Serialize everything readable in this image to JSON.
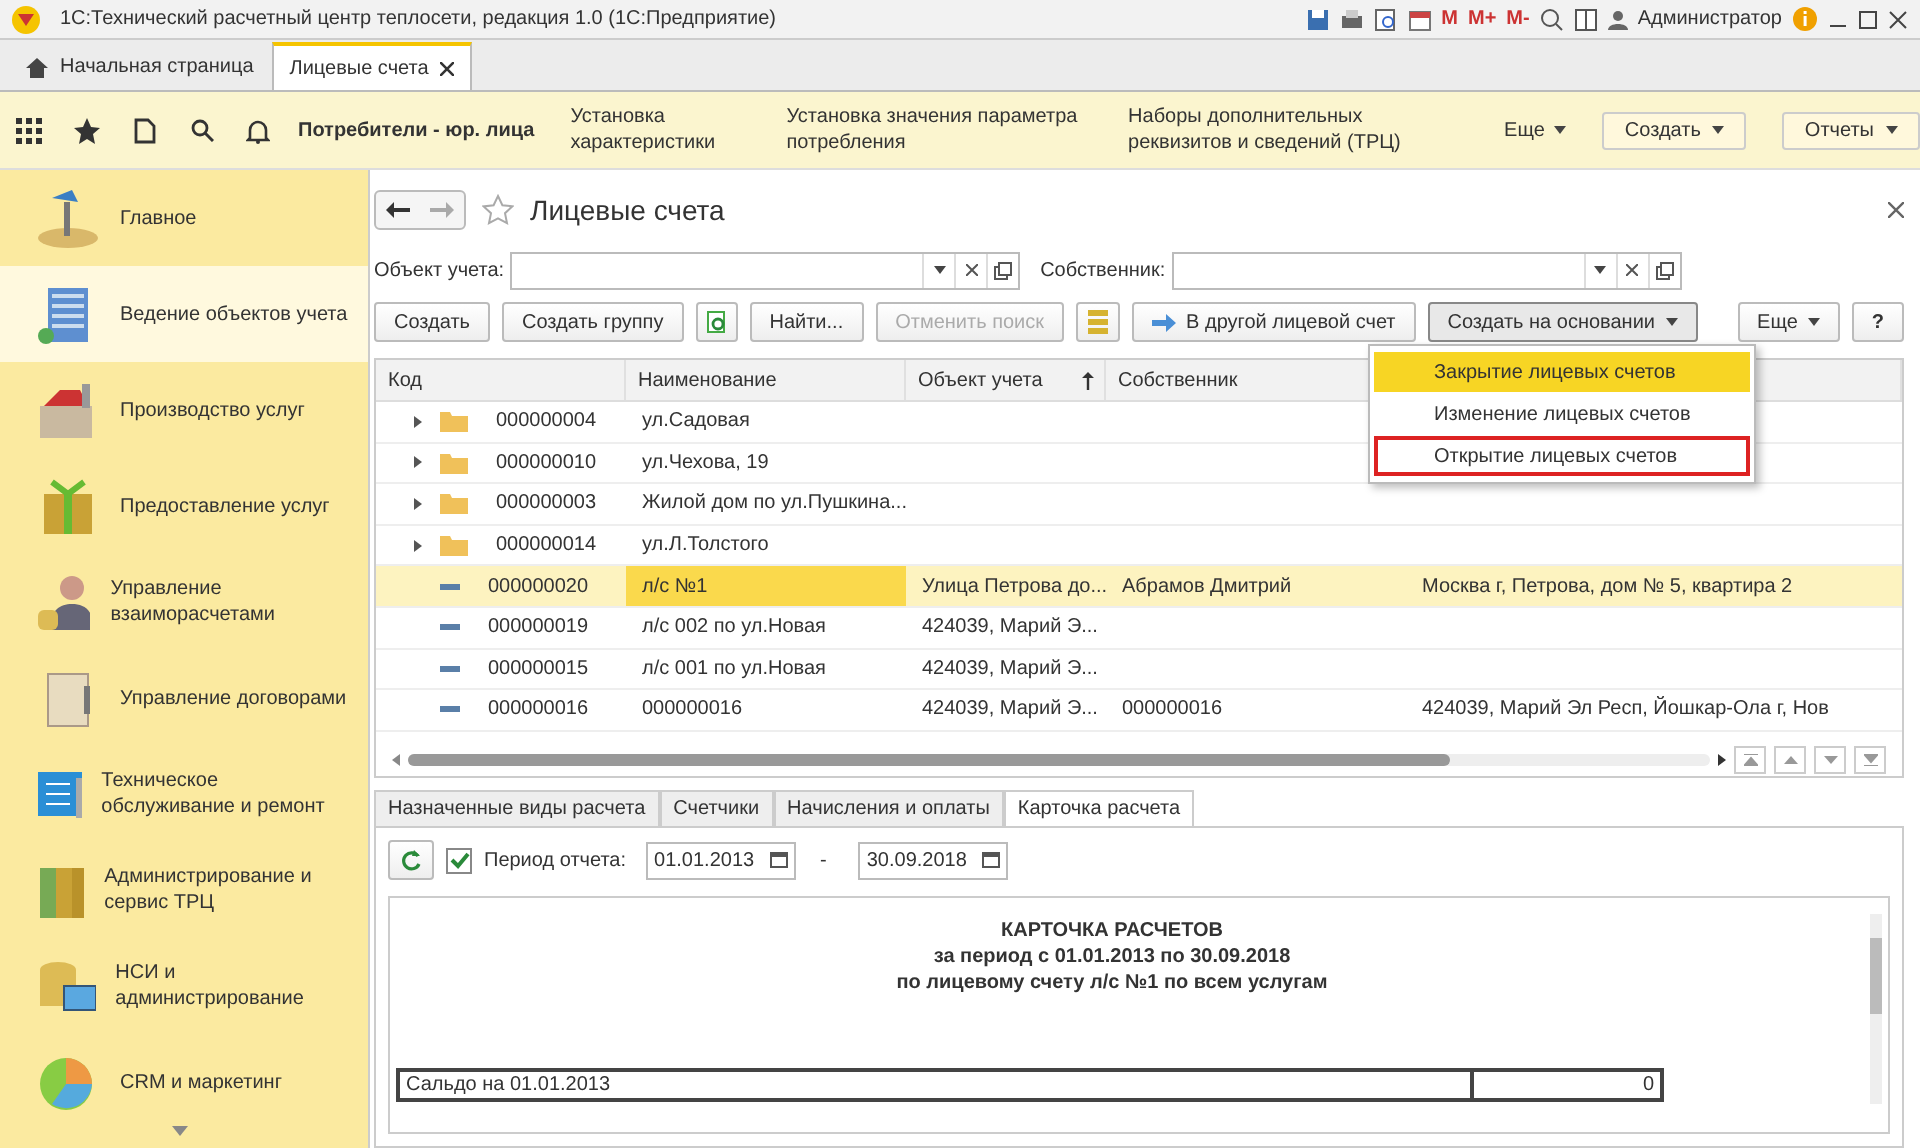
{
  "window": {
    "title": "1С:Технический расчетный центр теплосети, редакция 1.0  (1С:Предприятие)",
    "memory_buttons": [
      "M",
      "M+",
      "M-"
    ],
    "user": "Администратор"
  },
  "tabs": [
    {
      "label": "Начальная страница",
      "selected": false
    },
    {
      "label": "Лицевые счета",
      "selected": true
    }
  ],
  "navbar": {
    "section_title": "Потребители - юр. лица",
    "links": [
      "Установка характеристики",
      "Установка значения параметра потребления",
      "Наборы дополнительных реквизитов и сведений (ТРЦ)"
    ],
    "more": "Еще",
    "buttons": [
      "Создать",
      "Отчеты"
    ]
  },
  "sidebar": {
    "items": [
      {
        "label": "Главное",
        "selected": false
      },
      {
        "label": "Ведение объектов учета",
        "selected": true
      },
      {
        "label": "Производство услуг",
        "selected": false
      },
      {
        "label": "Предоставление услуг",
        "selected": false
      },
      {
        "label": "Управление взаиморасчетами",
        "selected": false
      },
      {
        "label": "Управление договорами",
        "selected": false
      },
      {
        "label": "Техническое обслуживание и ремонт",
        "selected": false
      },
      {
        "label": "Администрирование и сервис ТРЦ",
        "selected": false
      },
      {
        "label": "НСИ и администрирование",
        "selected": false
      },
      {
        "label": "CRM и маркетинг",
        "selected": false
      }
    ]
  },
  "form": {
    "title": "Лицевые счета",
    "filters": [
      {
        "label": "Объект учета:"
      },
      {
        "label": "Собственник:"
      }
    ],
    "buttons": [
      {
        "label": "Создать",
        "kind": "text",
        "disabled": false
      },
      {
        "label": "Создать группу",
        "kind": "text",
        "disabled": false
      },
      {
        "kind": "refresh-icon",
        "disabled": false
      },
      {
        "label": "Найти...",
        "kind": "text",
        "disabled": false
      },
      {
        "label": "Отменить поиск",
        "kind": "text",
        "disabled": true
      },
      {
        "kind": "list-icon",
        "disabled": false
      },
      {
        "label": "В другой лицевой счет",
        "kind": "arrow",
        "disabled": false
      },
      {
        "label": "Создать на основании",
        "kind": "menu",
        "disabled": false
      }
    ],
    "more": "Еще",
    "help": "?",
    "menu": [
      {
        "label": "Закрытие лицевых счетов",
        "selected": true,
        "marked": false
      },
      {
        "label": "Изменение лицевых счетов",
        "selected": false,
        "marked": false
      },
      {
        "label": "Открытие лицевых счетов",
        "selected": false,
        "marked": true
      }
    ],
    "table": {
      "columns": [
        {
          "label": "Код",
          "sorted": false
        },
        {
          "label": "Наименование",
          "sorted": false
        },
        {
          "label": "Объект учета",
          "sorted": true
        },
        {
          "label": "Собственник",
          "sorted": false
        }
      ],
      "rows": [
        {
          "kind": "group",
          "selected": false,
          "cells": [
            "000000004",
            "ул.Садовая",
            "",
            "",
            ""
          ]
        },
        {
          "kind": "group",
          "selected": false,
          "cells": [
            "000000010",
            "ул.Чехова, 19",
            "",
            "",
            ""
          ]
        },
        {
          "kind": "group",
          "selected": false,
          "cells": [
            "000000003",
            "Жилой дом по ул.Пушкина...",
            "",
            "",
            ""
          ]
        },
        {
          "kind": "group",
          "selected": false,
          "cells": [
            "000000014",
            "ул.Л.Толстого",
            "",
            "",
            ""
          ]
        },
        {
          "kind": "item",
          "selected": true,
          "cells": [
            "000000020",
            "л/с №1",
            "Улица Петрова до...",
            "Абрамов Дмитрий",
            "Москва г, Петрова, дом № 5, квартира 2"
          ]
        },
        {
          "kind": "item",
          "selected": false,
          "cells": [
            "000000019",
            "л/с 002 по ул.Новая",
            "424039, Марий Э...",
            "",
            ""
          ]
        },
        {
          "kind": "item",
          "selected": false,
          "cells": [
            "000000015",
            "л/с 001 по ул.Новая",
            "424039, Марий Э...",
            "",
            ""
          ]
        },
        {
          "kind": "item",
          "selected": false,
          "cells": [
            "000000016",
            "000000016",
            "424039, Марий Э...",
            "000000016",
            "424039, Марий Эл Респ, Йошкар-Ола г, Нов"
          ]
        }
      ]
    },
    "bottom_tabs": [
      {
        "label": "Назначенные виды расчета",
        "selected": false
      },
      {
        "label": "Счетчики",
        "selected": false
      },
      {
        "label": "Начисления и оплаты",
        "selected": false
      },
      {
        "label": "Карточка расчета",
        "selected": true
      }
    ],
    "period": {
      "checked": true,
      "label": "Период отчета:",
      "from": "01.01.2013",
      "separator": "-",
      "to": "30.09.2018"
    },
    "report": {
      "title_lines": [
        "КАРТОЧКА РАСЧЕТОВ",
        "за период с 01.01.2013 по 30.09.2018",
        "по лицевому счету л/с №1 по всем услугам"
      ],
      "rows": [
        {
          "label": "Сальдо на 01.01.2013",
          "value": "0"
        }
      ]
    }
  }
}
